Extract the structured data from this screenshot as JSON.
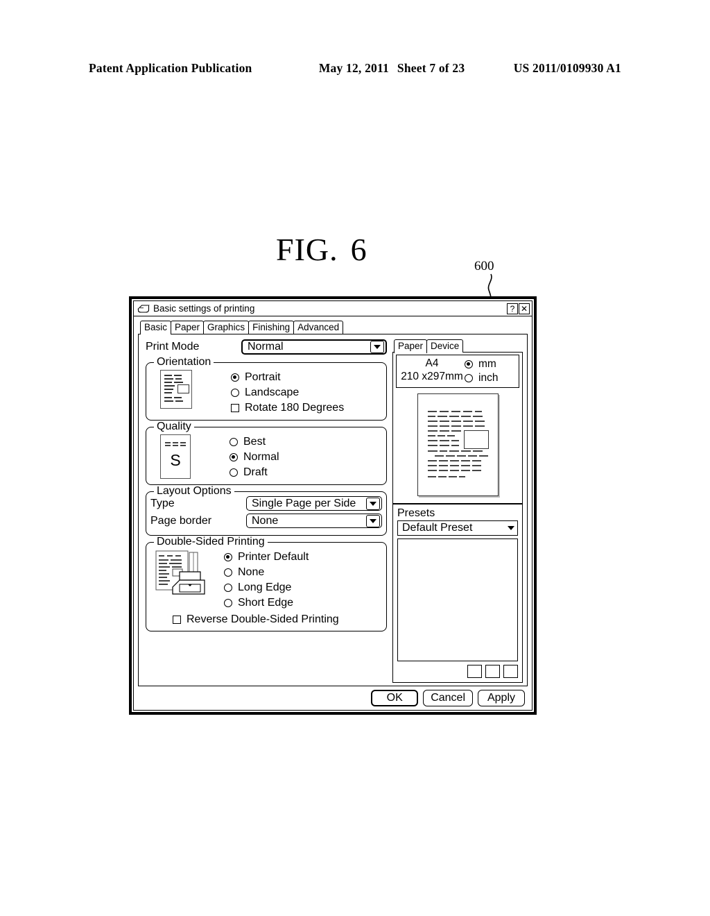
{
  "patent_header": {
    "publication": "Patent Application Publication",
    "date": "May 12, 2011",
    "sheet": "Sheet 7 of 23",
    "number": "US 2011/0109930 A1"
  },
  "figure": {
    "label": "FIG.",
    "number": "6",
    "reference_numeral": "600"
  },
  "dialog": {
    "title": "Basic settings of printing",
    "title_icon": "printer-icon",
    "help_button": "?",
    "close_button": "✕",
    "tabs": [
      {
        "label": "Basic",
        "active": true
      },
      {
        "label": "Paper",
        "active": false
      },
      {
        "label": "Graphics",
        "active": false
      },
      {
        "label": "Finishing",
        "active": false
      },
      {
        "label": "Advanced",
        "active": false
      }
    ],
    "print_mode": {
      "label": "Print Mode",
      "value": "Normal"
    },
    "orientation": {
      "title": "Orientation",
      "options": [
        {
          "label": "Portrait",
          "type": "radio",
          "checked": true
        },
        {
          "label": "Landscape",
          "type": "radio",
          "checked": false
        },
        {
          "label": "Rotate 180 Degrees",
          "type": "checkbox",
          "checked": false
        }
      ]
    },
    "quality": {
      "title": "Quality",
      "icon_letter": "S",
      "options": [
        {
          "label": "Best",
          "type": "radio",
          "checked": false
        },
        {
          "label": "Normal",
          "type": "radio",
          "checked": true
        },
        {
          "label": "Draft",
          "type": "radio",
          "checked": false
        }
      ]
    },
    "layout_options": {
      "title": "Layout Options",
      "type_label": "Type",
      "type_value": "Single Page per Side",
      "border_label": "Page border",
      "border_value": "None"
    },
    "double_sided": {
      "title": "Double-Sided Printing",
      "options": [
        {
          "label": "Printer Default",
          "type": "radio",
          "checked": true
        },
        {
          "label": "None",
          "type": "radio",
          "checked": false
        },
        {
          "label": "Long Edge",
          "type": "radio",
          "checked": false
        },
        {
          "label": "Short Edge",
          "type": "radio",
          "checked": false
        }
      ],
      "reverse_label": "Reverse Double-Sided Printing",
      "reverse_checked": false
    },
    "right_panel": {
      "tabs": [
        {
          "label": "Paper",
          "active": true
        },
        {
          "label": "Device",
          "active": false
        }
      ],
      "paper_name": "A4",
      "paper_dimensions": "210 x297mm",
      "units": [
        {
          "label": "mm",
          "checked": true
        },
        {
          "label": "inch",
          "checked": false
        }
      ],
      "presets": {
        "title": "Presets",
        "selected": "Default Preset",
        "list_items": [],
        "buttons": [
          "",
          "",
          ""
        ]
      }
    },
    "footer_buttons": [
      {
        "label": "OK",
        "default": true
      },
      {
        "label": "Cancel",
        "default": false
      },
      {
        "label": "Apply",
        "default": false
      }
    ]
  }
}
